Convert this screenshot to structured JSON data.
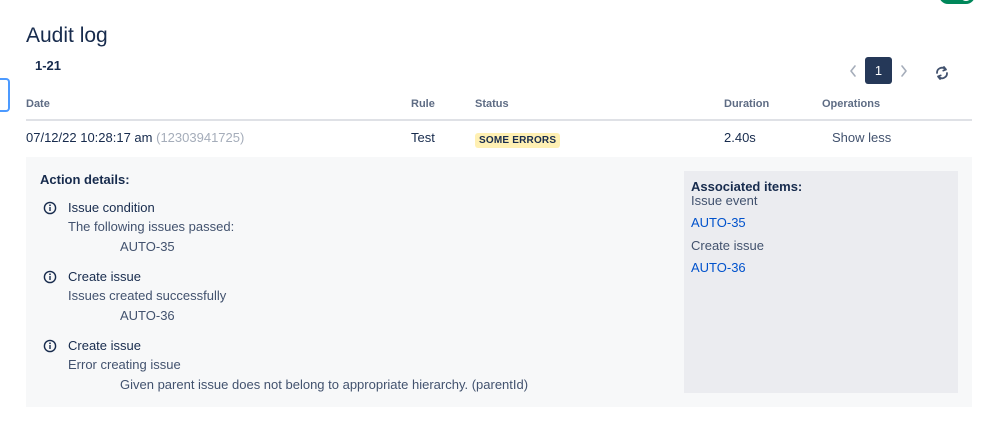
{
  "header": {
    "title": "Audit log",
    "range": "1-21"
  },
  "pagination": {
    "current_page": "1"
  },
  "table": {
    "columns": {
      "date": "Date",
      "rule": "Rule",
      "status": "Status",
      "duration": "Duration",
      "operations": "Operations"
    },
    "row": {
      "date": "07/12/22 10:28:17 am",
      "id": "(12303941725)",
      "rule": "Test",
      "status": "SOME ERRORS",
      "duration": "2.40s",
      "operation": "Show less"
    }
  },
  "details": {
    "title": "Action details:",
    "actions": [
      {
        "title": "Issue condition",
        "subtitle": "The following issues passed:",
        "detail": "AUTO-35"
      },
      {
        "title": "Create issue",
        "subtitle": "Issues created successfully",
        "detail": "AUTO-36"
      },
      {
        "title": "Create issue",
        "subtitle": "Error creating issue",
        "detail": "Given parent issue does not belong to appropriate hierarchy. (parentId)"
      }
    ],
    "associated": {
      "title": "Associated items:",
      "groups": [
        {
          "label": "Issue event",
          "link": "AUTO-35"
        },
        {
          "label": "Create issue",
          "link": "AUTO-36"
        }
      ]
    }
  },
  "colors": {
    "status_bg": "#fff0b3",
    "link": "#0052cc",
    "page_active": "#253858",
    "toggle": "#00875a"
  },
  "icons": {
    "prev": "chevron-left-icon",
    "next": "chevron-right-icon",
    "refresh": "refresh-icon",
    "info": "info-icon"
  }
}
